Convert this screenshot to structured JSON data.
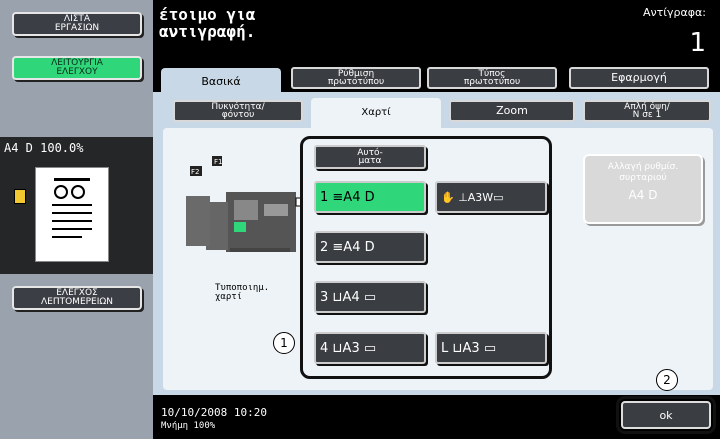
{
  "left": {
    "work_btn": "ΛΙΣΤΑ\nΕΡΓΑΣΙΩΝ",
    "check_btn": "ΛΕΙΤΟΥΡΓΙΑ\nΕΛΕΓΧΟΥ",
    "preview_text": "A4 D 100.0%",
    "details_btn": "ΕΛΕΓΧΟΣ\nΛΕΠΤΟΜΕΡΕΙΩΝ"
  },
  "header": {
    "title": "έτοιμο για\nαντιγραφή.",
    "copies_label": "Αντίγραφα:",
    "copies_value": "1"
  },
  "tabs": [
    "Βασικά",
    "Ρύθμιση\nπρωτοτύπου",
    "Τύπος\nπρωτοτύπου",
    "Εφαρμογή"
  ],
  "subtabs": [
    "Πυκνότητα/\nφόντου",
    "Χαρτί",
    "Zoom",
    "Απλή όψη/\nΝ σε 1"
  ],
  "machine": {
    "f1": "F1",
    "f2": "F2",
    "label": "Τυποποιημ.\nχαρτί"
  },
  "trays": {
    "auto": "Αυτό-\nματα",
    "t1": "1 ≡A4 D",
    "bypass": "✋ ⊥A3W▭",
    "t2": "2 ≡A4 D",
    "t3": "3 ⊔A4 ▭",
    "t4": "4 ⊔A3 ▭",
    "tL": "L ⊔A3 ▭"
  },
  "switch": {
    "label": "Αλλαγή ρυθμίσ.\nσυρταριού",
    "value": "A4 D"
  },
  "callouts": [
    "1",
    "2"
  ],
  "footer": {
    "datetime": "10/10/2008   10:20",
    "memory": "Μνήμη        100%",
    "ok": "ok"
  },
  "colors": {
    "accent_green": "#2fd67a",
    "panel_blue": "#c9d8e6",
    "dark_button": "#3a3d42"
  }
}
